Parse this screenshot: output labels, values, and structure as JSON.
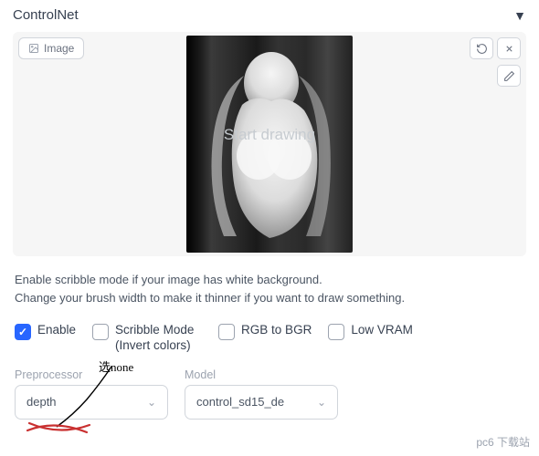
{
  "header": {
    "title": "ControlNet",
    "collapse_icon": "▼"
  },
  "tab": {
    "image_label": "Image"
  },
  "canvas": {
    "overlay_text": "Start drawing"
  },
  "info": {
    "line1": "Enable scribble mode if your image has white background.",
    "line2": "Change your brush width to make it thinner if you want to draw something."
  },
  "checkboxes": {
    "enable": {
      "label": "Enable",
      "checked": true
    },
    "scribble": {
      "label": "Scribble Mode (Invert colors)",
      "checked": false
    },
    "rgb_bgr": {
      "label": "RGB to BGR",
      "checked": false
    },
    "low_vram": {
      "label": "Low VRAM",
      "checked": false
    }
  },
  "dropdowns": {
    "preprocessor": {
      "label": "Preprocessor",
      "value": "depth"
    },
    "model": {
      "label": "Model",
      "value": "control_sd15_de"
    }
  },
  "annotation": {
    "note": "选none"
  },
  "watermark": "pc6 下载站"
}
